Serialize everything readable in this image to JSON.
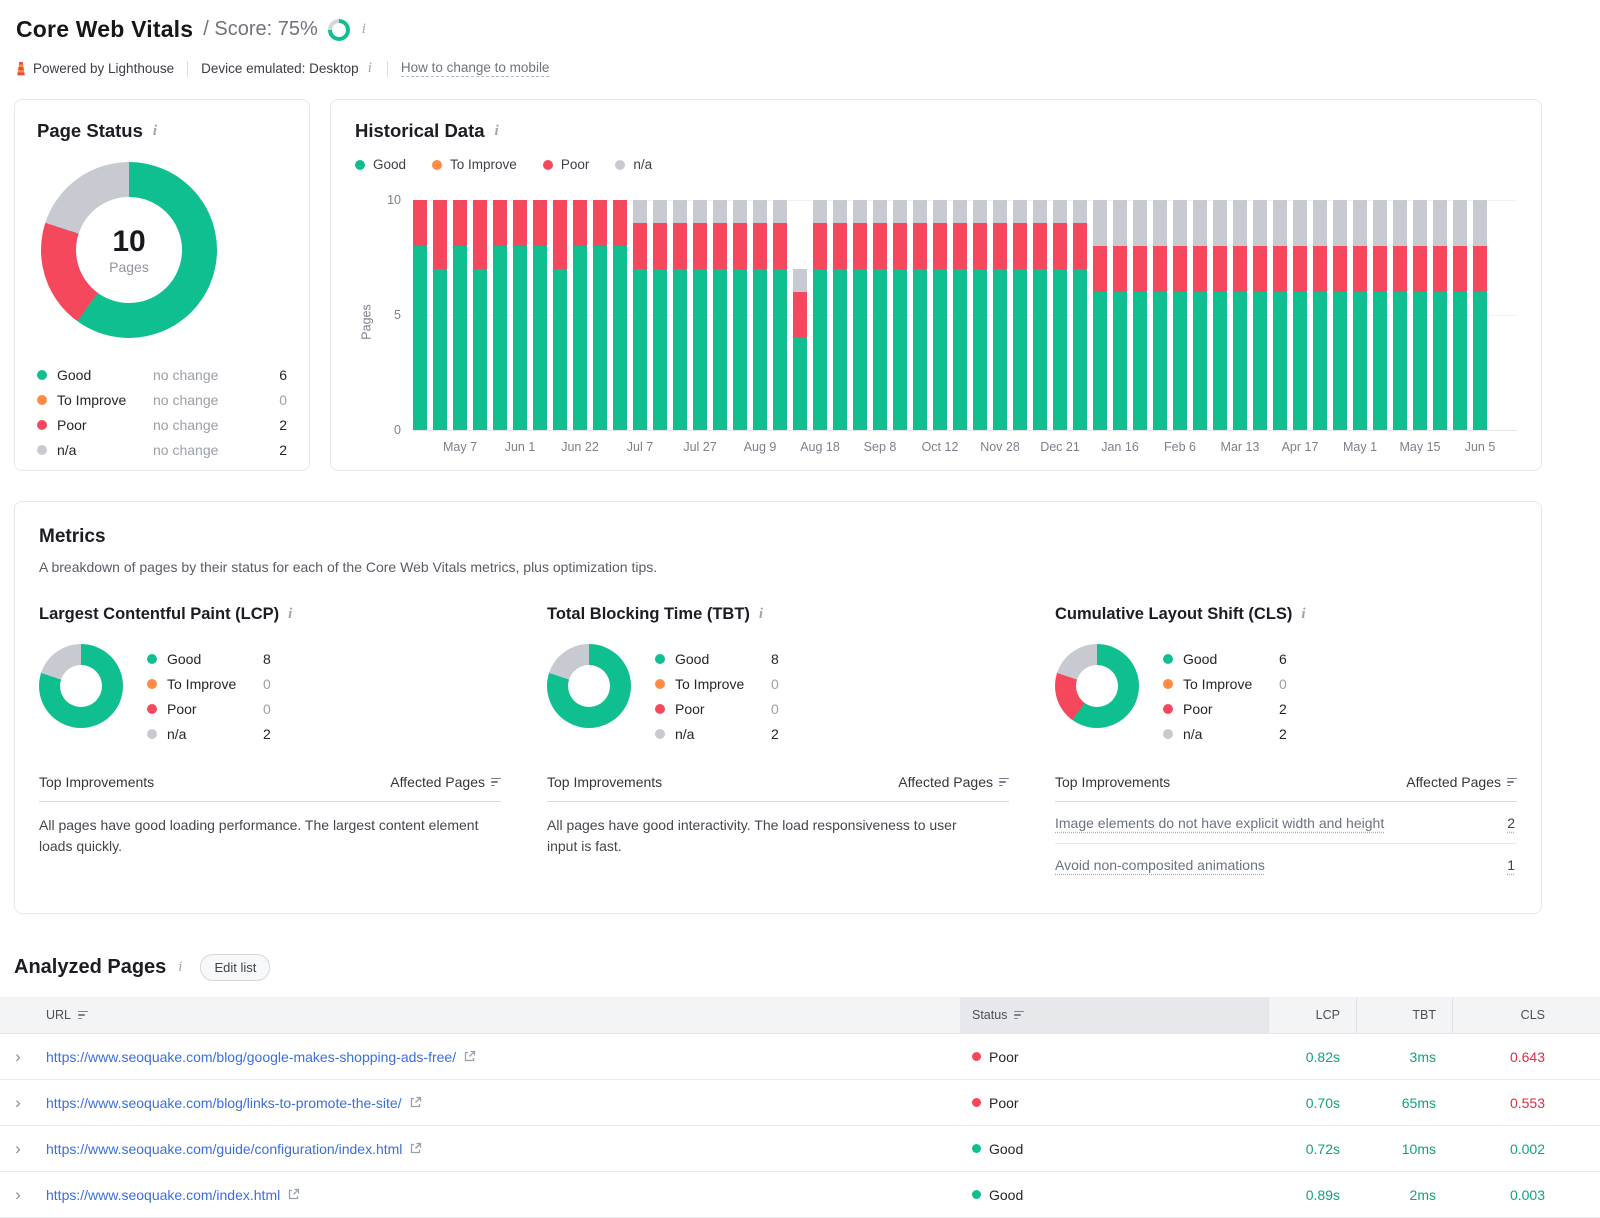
{
  "colors": {
    "good": "#10BF8F",
    "to_improve": "#FF8C43",
    "poor": "#F6485C",
    "na": "#C7CAD0",
    "score_rest": "#D2D5DA",
    "value_good": "#0FA37E",
    "value_poor": "#E02C44",
    "link_blue": "#3A6FDE"
  },
  "header": {
    "title": "Core Web Vitals",
    "score_text": "/ Score: 75%",
    "score_percent": 75,
    "powered_by": "Powered by Lighthouse",
    "device": "Device emulated: Desktop",
    "change_link": "How to change to mobile"
  },
  "page_status": {
    "title": "Page Status",
    "donut": {
      "total": "10",
      "total_label": "Pages",
      "segments": [
        {
          "status": "good",
          "pct": 60
        },
        {
          "status": "poor",
          "pct": 20
        },
        {
          "status": "na",
          "pct": 20
        }
      ]
    },
    "legend": [
      {
        "status": "good",
        "label": "Good",
        "change": "no change",
        "value": "6"
      },
      {
        "status": "to_improve",
        "label": "To Improve",
        "change": "no change",
        "value": "0"
      },
      {
        "status": "poor",
        "label": "Poor",
        "change": "no change",
        "value": "2"
      },
      {
        "status": "na",
        "label": "n/a",
        "change": "no change",
        "value": "2"
      }
    ]
  },
  "historical": {
    "title": "Historical Data",
    "legend": [
      {
        "status": "good",
        "label": "Good"
      },
      {
        "status": "to_improve",
        "label": "To Improve"
      },
      {
        "status": "poor",
        "label": "Poor"
      },
      {
        "status": "na",
        "label": "n/a"
      }
    ]
  },
  "chart_data": {
    "type": "bar",
    "stacked": true,
    "title": "Historical Data",
    "ylabel": "Pages",
    "ylim": [
      0,
      10
    ],
    "yticks": [
      "10",
      "5",
      "0"
    ],
    "legend_position": "top",
    "series_order_bottom_up": [
      "good",
      "poor",
      "na"
    ],
    "bars": [
      {
        "good": 8,
        "poor": 2,
        "na": 0
      },
      {
        "good": 7,
        "poor": 3,
        "na": 0
      },
      {
        "good": 8,
        "poor": 2,
        "na": 0,
        "label": "May 7"
      },
      {
        "good": 7,
        "poor": 3,
        "na": 0
      },
      {
        "good": 8,
        "poor": 2,
        "na": 0
      },
      {
        "good": 8,
        "poor": 2,
        "na": 0,
        "label": "Jun 1"
      },
      {
        "good": 8,
        "poor": 2,
        "na": 0
      },
      {
        "good": 7,
        "poor": 3,
        "na": 0
      },
      {
        "good": 8,
        "poor": 2,
        "na": 0,
        "label": "Jun 22"
      },
      {
        "good": 8,
        "poor": 2,
        "na": 0
      },
      {
        "good": 8,
        "poor": 2,
        "na": 0
      },
      {
        "good": 7,
        "poor": 2,
        "na": 1,
        "label": "Jul 7"
      },
      {
        "good": 7,
        "poor": 2,
        "na": 1
      },
      {
        "good": 7,
        "poor": 2,
        "na": 1
      },
      {
        "good": 7,
        "poor": 2,
        "na": 1,
        "label": "Jul 27"
      },
      {
        "good": 7,
        "poor": 2,
        "na": 1
      },
      {
        "good": 7,
        "poor": 2,
        "na": 1
      },
      {
        "good": 7,
        "poor": 2,
        "na": 1,
        "label": "Aug 9"
      },
      {
        "good": 7,
        "poor": 2,
        "na": 1
      },
      {
        "good": 4,
        "poor": 2,
        "na": 1
      },
      {
        "good": 7,
        "poor": 2,
        "na": 1,
        "label": "Aug 18"
      },
      {
        "good": 7,
        "poor": 2,
        "na": 1
      },
      {
        "good": 7,
        "poor": 2,
        "na": 1
      },
      {
        "good": 7,
        "poor": 2,
        "na": 1,
        "label": "Sep 8"
      },
      {
        "good": 7,
        "poor": 2,
        "na": 1
      },
      {
        "good": 7,
        "poor": 2,
        "na": 1
      },
      {
        "good": 7,
        "poor": 2,
        "na": 1,
        "label": "Oct 12"
      },
      {
        "good": 7,
        "poor": 2,
        "na": 1
      },
      {
        "good": 7,
        "poor": 2,
        "na": 1
      },
      {
        "good": 7,
        "poor": 2,
        "na": 1,
        "label": "Nov 28"
      },
      {
        "good": 7,
        "poor": 2,
        "na": 1
      },
      {
        "good": 7,
        "poor": 2,
        "na": 1
      },
      {
        "good": 7,
        "poor": 2,
        "na": 1,
        "label": "Dec 21"
      },
      {
        "good": 7,
        "poor": 2,
        "na": 1
      },
      {
        "good": 6,
        "poor": 2,
        "na": 2
      },
      {
        "good": 6,
        "poor": 2,
        "na": 2,
        "label": "Jan 16"
      },
      {
        "good": 6,
        "poor": 2,
        "na": 2
      },
      {
        "good": 6,
        "poor": 2,
        "na": 2
      },
      {
        "good": 6,
        "poor": 2,
        "na": 2,
        "label": "Feb 6"
      },
      {
        "good": 6,
        "poor": 2,
        "na": 2
      },
      {
        "good": 6,
        "poor": 2,
        "na": 2
      },
      {
        "good": 6,
        "poor": 2,
        "na": 2,
        "label": "Mar 13"
      },
      {
        "good": 6,
        "poor": 2,
        "na": 2
      },
      {
        "good": 6,
        "poor": 2,
        "na": 2
      },
      {
        "good": 6,
        "poor": 2,
        "na": 2,
        "label": "Apr 17"
      },
      {
        "good": 6,
        "poor": 2,
        "na": 2
      },
      {
        "good": 6,
        "poor": 2,
        "na": 2
      },
      {
        "good": 6,
        "poor": 2,
        "na": 2,
        "label": "May 1"
      },
      {
        "good": 6,
        "poor": 2,
        "na": 2
      },
      {
        "good": 6,
        "poor": 2,
        "na": 2
      },
      {
        "good": 6,
        "poor": 2,
        "na": 2,
        "label": "May 15"
      },
      {
        "good": 6,
        "poor": 2,
        "na": 2
      },
      {
        "good": 6,
        "poor": 2,
        "na": 2
      },
      {
        "good": 6,
        "poor": 2,
        "na": 2,
        "label": "Jun 5"
      }
    ]
  },
  "metrics": {
    "title": "Metrics",
    "subtitle": "A breakdown of pages by their status for each of the Core Web Vitals metrics, plus optimization tips.",
    "improvements_header": "Top Improvements",
    "affected_header": "Affected Pages",
    "cards": [
      {
        "title": "Largest Contentful Paint (LCP)",
        "donut": {
          "segments": [
            {
              "status": "good",
              "pct": 80
            },
            {
              "status": "na",
              "pct": 20
            }
          ]
        },
        "legend": [
          {
            "status": "good",
            "label": "Good",
            "value": "8"
          },
          {
            "status": "to_improve",
            "label": "To Improve",
            "value": "0"
          },
          {
            "status": "poor",
            "label": "Poor",
            "value": "0"
          },
          {
            "status": "na",
            "label": "n/a",
            "value": "2"
          }
        ],
        "note": "All pages have good loading performance. The largest content element loads quickly."
      },
      {
        "title": "Total Blocking Time (TBT)",
        "donut": {
          "segments": [
            {
              "status": "good",
              "pct": 80
            },
            {
              "status": "na",
              "pct": 20
            }
          ]
        },
        "legend": [
          {
            "status": "good",
            "label": "Good",
            "value": "8"
          },
          {
            "status": "to_improve",
            "label": "To Improve",
            "value": "0"
          },
          {
            "status": "poor",
            "label": "Poor",
            "value": "0"
          },
          {
            "status": "na",
            "label": "n/a",
            "value": "2"
          }
        ],
        "note": "All pages have good interactivity. The load responsiveness to user input is fast."
      },
      {
        "title": "Cumulative Layout Shift (CLS)",
        "donut": {
          "segments": [
            {
              "status": "good",
              "pct": 60
            },
            {
              "status": "poor",
              "pct": 20
            },
            {
              "status": "na",
              "pct": 20
            }
          ]
        },
        "legend": [
          {
            "status": "good",
            "label": "Good",
            "value": "6"
          },
          {
            "status": "to_improve",
            "label": "To Improve",
            "value": "0"
          },
          {
            "status": "poor",
            "label": "Poor",
            "value": "2"
          },
          {
            "status": "na",
            "label": "n/a",
            "value": "2"
          }
        ],
        "improvements": [
          {
            "label": "Image elements do not have explicit width and height",
            "count": "2"
          },
          {
            "label": "Avoid non-composited animations",
            "count": "1"
          }
        ]
      }
    ]
  },
  "analyzed": {
    "title": "Analyzed Pages",
    "edit_button": "Edit list",
    "columns": {
      "url": "URL",
      "status": "Status",
      "lcp": "LCP",
      "tbt": "TBT",
      "cls": "CLS"
    },
    "rows": [
      {
        "url": "https://www.seoquake.com/blog/google-makes-shopping-ads-free/",
        "status": "Poor",
        "status_key": "poor",
        "lcp": "0.82s",
        "tbt": "3ms",
        "cls": "0.643",
        "cls_key": "poor"
      },
      {
        "url": "https://www.seoquake.com/blog/links-to-promote-the-site/",
        "status": "Poor",
        "status_key": "poor",
        "lcp": "0.70s",
        "tbt": "65ms",
        "cls": "0.553",
        "cls_key": "poor"
      },
      {
        "url": "https://www.seoquake.com/guide/configuration/index.html",
        "status": "Good",
        "status_key": "good",
        "lcp": "0.72s",
        "tbt": "10ms",
        "cls": "0.002",
        "cls_key": "good"
      },
      {
        "url": "https://www.seoquake.com/index.html",
        "status": "Good",
        "status_key": "good",
        "lcp": "0.89s",
        "tbt": "2ms",
        "cls": "0.003",
        "cls_key": "good"
      }
    ]
  }
}
